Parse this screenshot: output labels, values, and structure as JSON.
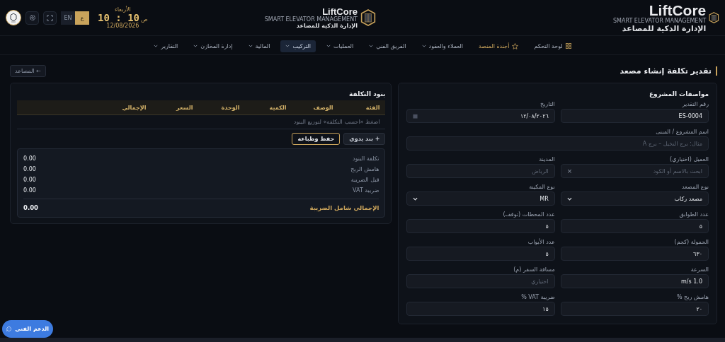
{
  "header": {
    "brand": {
      "name": "LiftCore",
      "tagline": "SMART ELEVATOR MANAGEMENT",
      "subtitle": "الإدارة الذكية للمصاعد"
    },
    "center_brand": {
      "name": "LiftCore",
      "tagline": "SMART ELEVATOR MANAGEMENT",
      "subtitle": "الإدارة الذكية للمصاعد"
    },
    "clock": {
      "day": "الأربعاء",
      "time": "10 : 10",
      "period": "ص",
      "date": "12/08/2026"
    },
    "languages": [
      {
        "label": "ع",
        "selected": true
      },
      {
        "label": "EN",
        "selected": false
      }
    ]
  },
  "nav": [
    {
      "label": "لوحة التحكم",
      "kind": "dashboard",
      "selected": false
    },
    {
      "label": "أجندة المنصة",
      "kind": "agenda",
      "selected": false
    },
    {
      "label": "العملاء والعقود",
      "kind": "menu",
      "selected": false
    },
    {
      "label": "الفريق الفني",
      "kind": "menu",
      "selected": false
    },
    {
      "label": "العمليات",
      "kind": "menu",
      "selected": false
    },
    {
      "label": "التركيب",
      "kind": "menu",
      "selected": true
    },
    {
      "label": "المالية",
      "kind": "menu",
      "selected": false
    },
    {
      "label": "إدارة المخازن",
      "kind": "menu",
      "selected": false
    },
    {
      "label": "التقارير",
      "kind": "menu",
      "selected": false
    }
  ],
  "page": {
    "title": "تقدير تكلفة إنشاء مصعد",
    "back_button": "← المصاعد"
  },
  "specs": {
    "title": "مواصفات المشروع",
    "rows": [
      [
        {
          "label": "رقم التقدير",
          "value": "ES-0004",
          "kind": "text"
        },
        {
          "label": "التاريخ",
          "value": "١٢/٠٨/٢٠٢٦",
          "kind": "date"
        }
      ],
      [
        {
          "label": "اسم المشروع / المبنى",
          "placeholder": "مثال: برج النخيل – برج A",
          "kind": "text"
        }
      ],
      [
        {
          "label": "العميل (اختياري)",
          "placeholder": "ابحث بالاسم أو الكود",
          "kind": "search",
          "clear": "×"
        },
        {
          "label": "المدينة",
          "placeholder": "الرياض",
          "kind": "text"
        }
      ],
      [
        {
          "label": "نوع المصعد",
          "value": "مصعد ركاب",
          "kind": "select"
        },
        {
          "label": "نوع المكينة",
          "value": "MR",
          "kind": "select"
        }
      ],
      [
        {
          "label": "عدد الطوابق",
          "value": "٥",
          "kind": "text"
        },
        {
          "label": "عدد المحطات (توقف)",
          "value": "٥",
          "kind": "text"
        }
      ],
      [
        {
          "label": "الحمولة (كجم)",
          "value": "٦٣٠",
          "kind": "text"
        },
        {
          "label": "عدد الأبواب",
          "value": "٥",
          "kind": "text"
        }
      ],
      [
        {
          "label": "السرعة",
          "value": "1.0 m/s",
          "kind": "text"
        },
        {
          "label": "مسافة السفر (م)",
          "placeholder": "اختياري",
          "kind": "text"
        }
      ],
      [
        {
          "label": "هامش ربح %",
          "value": "٢٠",
          "kind": "text"
        },
        {
          "label": "ضريبة VAT %",
          "value": "١٥",
          "kind": "text"
        }
      ]
    ]
  },
  "costs": {
    "title": "بنود التكلفة",
    "columns": [
      "الفئة",
      "الوصف",
      "الكمية",
      "الوحدة",
      "السعر",
      "الإجمالي"
    ],
    "empty_message": "اضغط «احسب التكلفة» لتوزيع البنود",
    "buttons": [
      {
        "label": "+ بند يدوي",
        "kind": "secondary"
      },
      {
        "label": "حفظ وطباعة",
        "kind": "primary"
      }
    ],
    "summary": [
      {
        "label": "تكلفة البنود",
        "value": "0.00"
      },
      {
        "label": "هامش الربح",
        "value": "0.00"
      },
      {
        "label": "قبل الضريبة",
        "value": "0.00"
      },
      {
        "label": "ضريبة VAT",
        "value": "0.00"
      }
    ],
    "total": {
      "label": "الإجمالي شامل الضريبة",
      "value": "0.00"
    }
  },
  "support_button": "الدعم الفني"
}
